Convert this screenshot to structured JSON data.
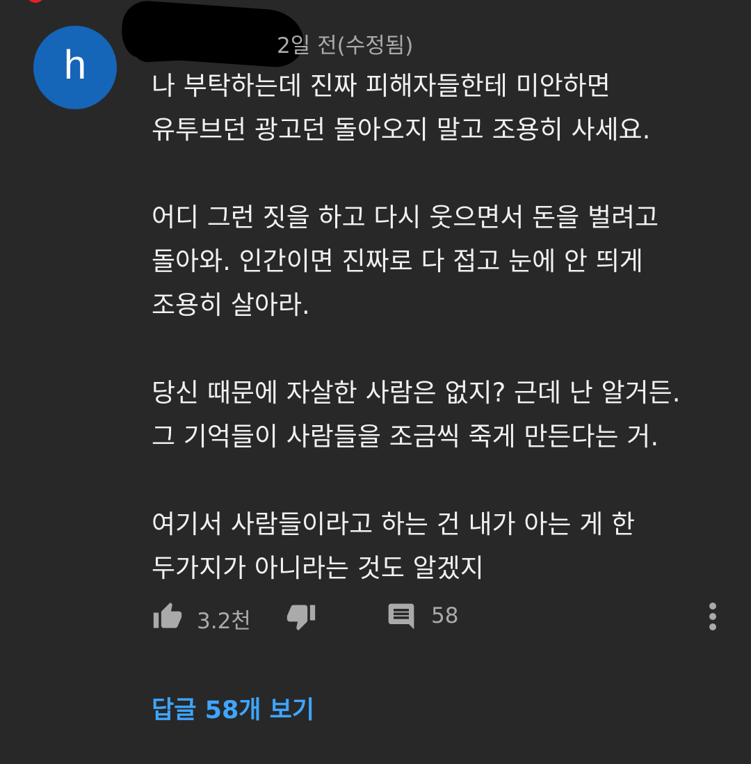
{
  "comment": {
    "avatar_letter": "h",
    "meta": "2일 전(수정됨)",
    "paragraphs": [
      {
        "lines": [
          "나 부탁하는데 진짜 피해자들한테 미안하면",
          "유투브던 광고던 돌아오지 말고 조용히 사세요."
        ]
      },
      {
        "lines": [
          "어디 그런 짓을 하고 다시 웃으면서 돈을 벌려고",
          "돌아와. 인간이면 진짜로 다 접고 눈에 안 띄게",
          "조용히 살아라."
        ]
      },
      {
        "lines": [
          "당신 때문에 자살한 사람은 없지? 근데 난 알거든.",
          "그 기억들이 사람들을 조금씩 죽게 만든다는 거."
        ]
      },
      {
        "lines": [
          "여기서 사람들이라고 하는 건 내가 아는 게 한",
          "두가지가 아니라는 것도 알겠지"
        ]
      }
    ],
    "like_count": "3.2천",
    "reply_count": "58",
    "view_replies_label": "답글 58개 보기"
  },
  "colors": {
    "background": "#282828",
    "avatar": "#1565b8",
    "link": "#3ea6ff",
    "secondary_text": "#aaaaaa",
    "primary_text": "#f1f1f1"
  },
  "icons": [
    "thumb-up-icon",
    "thumb-down-icon",
    "comment-icon",
    "more-vertical-icon"
  ]
}
